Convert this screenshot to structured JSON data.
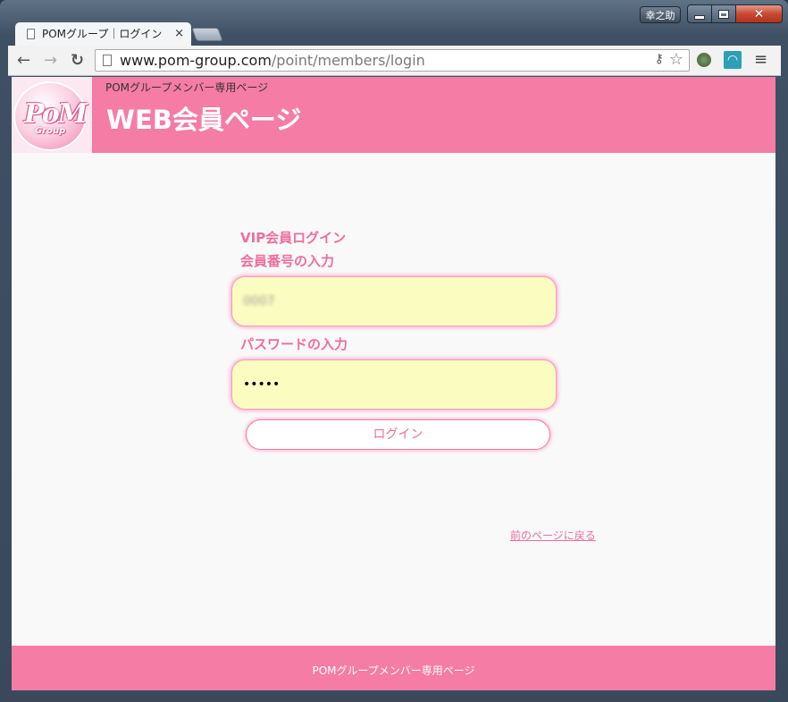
{
  "window": {
    "user_badge": "幸之助"
  },
  "tab": {
    "title": "POMグループ｜ログイン",
    "close": "×"
  },
  "toolbar": {
    "back": "←",
    "forward": "→",
    "reload": "↻",
    "url_host": "www.pom-group.com",
    "url_path": "/point/members/login",
    "menu": "≡"
  },
  "header": {
    "logo_text": "PoM",
    "logo_sub": "Group",
    "subtitle": "POMグループメンバー専用ページ",
    "title": "WEB会員ページ"
  },
  "form": {
    "vip_heading": "VIP会員ログイン",
    "member_no_label": "会員番号の入力",
    "member_no_value": "0007",
    "password_label": "パスワードの入力",
    "password_value": "•••••",
    "login_button": "ログイン"
  },
  "back_link": "前のページに戻る",
  "footer": {
    "text": "POMグループメンバー専用ページ"
  },
  "colors": {
    "brand_pink": "#f57ca5",
    "accent_text": "#ef6e9d",
    "field_bg": "#fbfdc0"
  }
}
